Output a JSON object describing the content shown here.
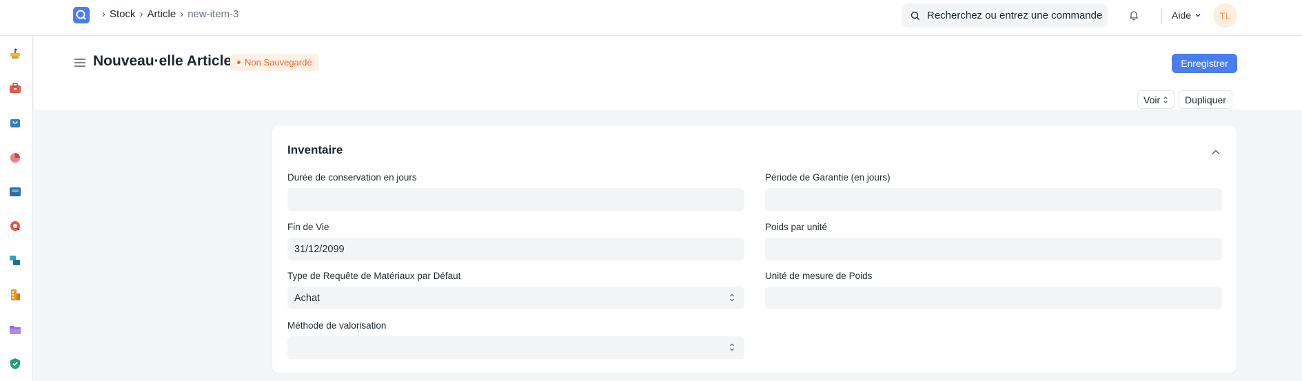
{
  "navbar": {
    "breadcrumbs": [
      "Stock",
      "Article",
      "new-item-3"
    ],
    "search_placeholder": "Recherchez ou entrez une commande",
    "help_label": "Aide",
    "avatar_initials": "TL",
    "accent": "#4a7ef0"
  },
  "sidebar": {
    "icons": [
      "toolbox-icon",
      "briefcase-icon",
      "shopping-bag-icon",
      "pie-chart-icon",
      "inbox-icon",
      "support-icon",
      "stack-icon",
      "building-icon",
      "folder-icon",
      "shield-icon"
    ]
  },
  "page": {
    "title": "Nouveau·elle Article",
    "status_badge": "Non Sauvegardé",
    "save_label": "Enregistrer",
    "view_label": "Voir",
    "duplicate_label": "Dupliquer"
  },
  "section": {
    "title": "Inventaire",
    "fields": {
      "shelf_life_label": "Durée de conservation en jours",
      "shelf_life_value": "",
      "warranty_label": "Période de Garantie (en jours)",
      "warranty_value": "",
      "end_of_life_label": "Fin de Vie",
      "end_of_life_value": "31/12/2099",
      "weight_per_unit_label": "Poids par unité",
      "weight_per_unit_value": "",
      "material_request_type_label": "Type de Requête de Matériaux par Défaut",
      "material_request_type_value": "Achat",
      "weight_uom_label": "Unité de mesure de Poids",
      "weight_uom_value": "",
      "valuation_method_label": "Méthode de valorisation",
      "valuation_method_value": ""
    }
  }
}
